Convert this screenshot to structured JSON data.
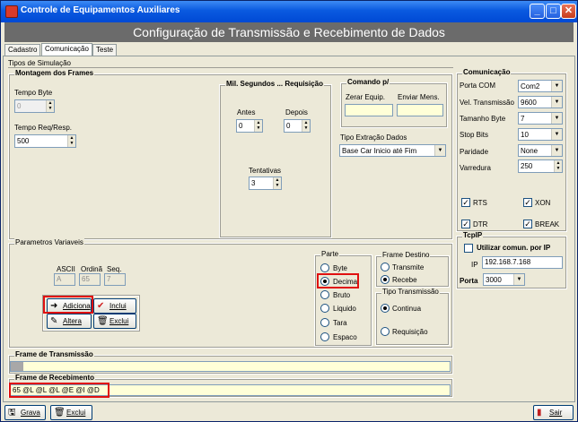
{
  "window": {
    "title": "Controle de Equipamentos Auxiliares",
    "min": "_",
    "max": "□",
    "close": "✕"
  },
  "banner": {
    "title": "Configuração de Transmissão e Recebimento de Dados"
  },
  "tabs": [
    "Cadastro",
    "Comunicação",
    "Teste"
  ],
  "simulacao": {
    "label": "Tipos de Simulação"
  },
  "montagem": {
    "label": "Montagem dos Frames",
    "tempo_byte_label": "Tempo Byte",
    "tempo_byte_value": "0",
    "tempo_req_label": "Tempo Req/Resp.",
    "tempo_req_value": "500"
  },
  "milisegundos": {
    "label": "Mil. Segundos ... Requisição",
    "antes_label": "Antes",
    "antes_value": "0",
    "depois_label": "Depois",
    "depois_value": "0",
    "tentativas_label": "Tentativas",
    "tentativas_value": "3"
  },
  "comando": {
    "label": "Comando p/",
    "zerar_label": "Zerar Equip.",
    "enviar_label": "Enviar Mens.",
    "zerar_value": "",
    "enviar_value": ""
  },
  "extracao": {
    "label": "Tipo Extração Dados",
    "value": "Base Car Inicio até Fim"
  },
  "comunicacao": {
    "label": "Comunicação",
    "fields": [
      {
        "label": "Porta COM",
        "value": "Com2"
      },
      {
        "label": "Vel. Transmissão",
        "value": "9600"
      },
      {
        "label": "Tamanho Byte",
        "value": "7"
      },
      {
        "label": "Stop Bits",
        "value": "10"
      },
      {
        "label": "Paridade",
        "value": "None"
      },
      {
        "label": "Varredura",
        "value": "250"
      }
    ],
    "rts": "RTS",
    "xon": "XON",
    "dtr": "DTR",
    "brk": "BREAK"
  },
  "tcpip": {
    "label": "TcpIP",
    "utilizar": "Utilizar comun. por IP",
    "ip_label": "IP",
    "ip_value": "192.168.7.168",
    "porta_label": "Porta",
    "porta_value": "3000"
  },
  "parametros": {
    "label": "Parametros Variaveis",
    "ascii_label": "ASCII",
    "ordina_label": "Ordinã",
    "seq_label": "Seq.",
    "ascii_value": "A",
    "ordina_value": "65",
    "seq_value": "7",
    "adiciona": "Adiciona",
    "inclui": "Inclui",
    "altera": "Altera",
    "exclui": "Exclui"
  },
  "parte": {
    "label": "Parte",
    "options": [
      "Byte",
      "Decima",
      "Bruto",
      "Liquido",
      "Tara",
      "Espaco"
    ],
    "selected": "Decima"
  },
  "frame_destino": {
    "label": "Frame Destino",
    "options": [
      "Transmite",
      "Recebe"
    ],
    "selected": "Recebe"
  },
  "tipo_transmissao": {
    "label": "Tipo Transmissão",
    "options": [
      "Continua",
      "Requisição"
    ],
    "selected": "Continua"
  },
  "frame_transmissao": {
    "label": "Frame de Transmissão",
    "value": ""
  },
  "frame_recebimento": {
    "label": "Frame de Recebimento",
    "value": "65 @L @L @L @E @I @D"
  },
  "bottom": {
    "grava": "Grava",
    "exclui": "Exclui",
    "sair": "Sair"
  }
}
